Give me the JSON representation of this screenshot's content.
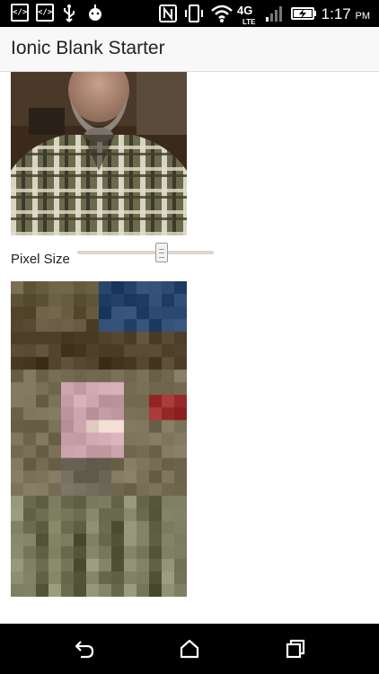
{
  "status_bar": {
    "time": "1:17",
    "ampm": "PM",
    "network": "4G",
    "network_sub": "LTE",
    "icons": [
      "code-notification-icon",
      "code-notification-icon",
      "usb-icon",
      "android-debug-icon",
      "nfc-icon",
      "vibrate-icon",
      "wifi-icon",
      "signal-icon",
      "battery-charging-icon"
    ]
  },
  "header": {
    "title": "Ionic Blank Starter"
  },
  "controls": {
    "pixel_size_label": "Pixel Size",
    "pixel_size_value": 0.63
  },
  "nav": {
    "icons": [
      "back-icon",
      "home-icon",
      "recent-apps-icon"
    ]
  },
  "colors": {
    "status_bar_bg": "#000000",
    "header_bg": "#f8f8f8",
    "nav_bar_bg": "#000000"
  }
}
